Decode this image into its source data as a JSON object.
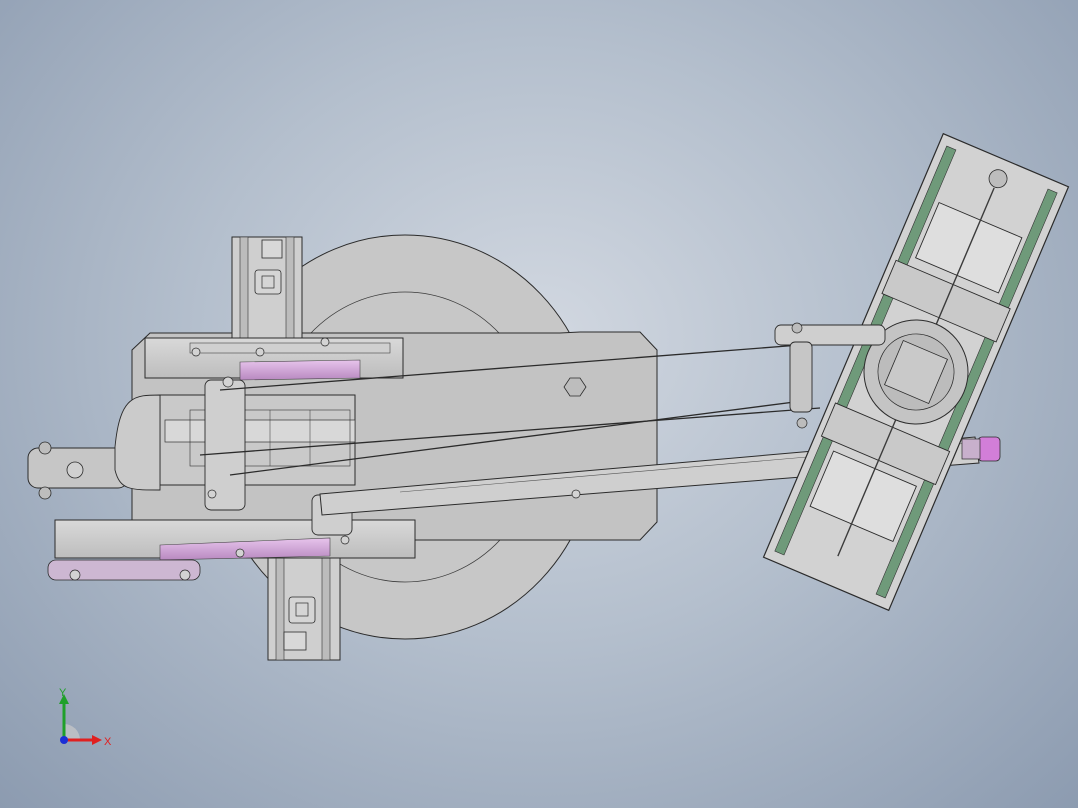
{
  "viewport": {
    "background_top": "#8c9bb0",
    "background_center": "#d2d8e1",
    "part_fill": "#c8c8c8",
    "part_fill_dark": "#b9b9b9",
    "edge_color": "#2b2b2b",
    "accent_purple": "#b07ab8",
    "rail_green": "#5f8a6a"
  },
  "triad": {
    "x_label": "X",
    "y_label": "Y",
    "x_color": "#e02020",
    "y_color": "#1fa02a",
    "z_color": "#1c2fd6"
  }
}
